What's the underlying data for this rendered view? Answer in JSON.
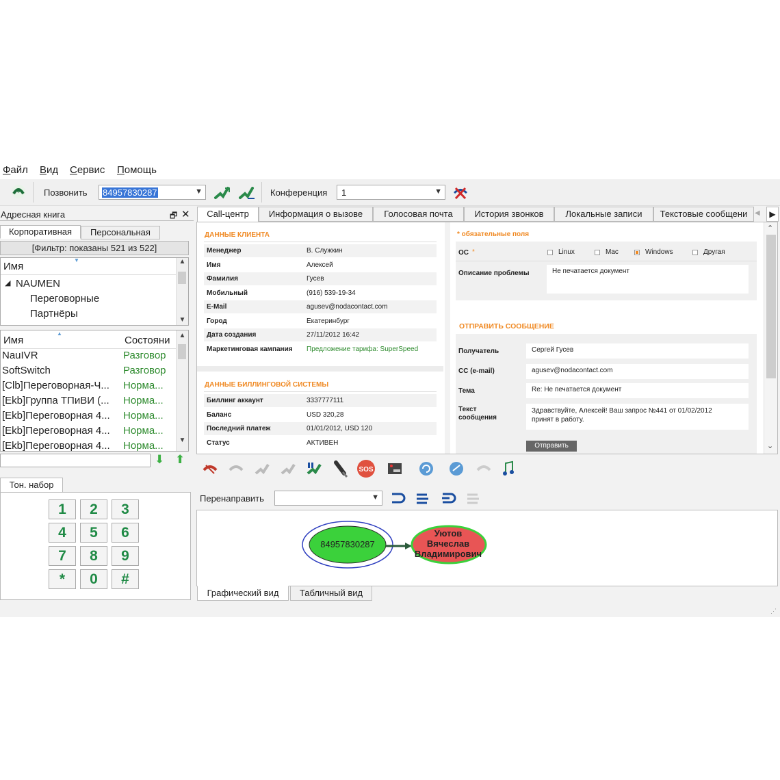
{
  "menu": [
    "Файл",
    "Вид",
    "Сервис",
    "Помощь"
  ],
  "toolbar": {
    "call_label": "Позвонить",
    "call_number": "84957830287",
    "conference_label": "Конференция",
    "conference_value": "1"
  },
  "address_book": {
    "title": "Адресная книга",
    "tabs": [
      "Корпоративная",
      "Персональная"
    ],
    "filter_text": "[Фильтр: показаны 521 из 522]",
    "tree_header": "Имя",
    "tree": [
      "NAUMEN",
      "Переговорные",
      "Партнёры"
    ],
    "list_headers": [
      "Имя",
      "Состояни"
    ],
    "rows": [
      {
        "name": "NauIVR",
        "state": "Разговор"
      },
      {
        "name": "SoftSwitch",
        "state": "Разговор"
      },
      {
        "name": "[Clb]Переговорная-Ч...",
        "state": "Норма..."
      },
      {
        "name": "[Ekb]Группа ТПиВИ (...",
        "state": "Норма..."
      },
      {
        "name": "[Ekb]Переговорная 4...",
        "state": "Норма..."
      },
      {
        "name": "[Ekb]Переговорная 4...",
        "state": "Норма..."
      },
      {
        "name": "[Ekb]Переговорная 4...",
        "state": "Норма..."
      }
    ]
  },
  "dialpad": {
    "tab": "Тон. набор",
    "keys": [
      "1",
      "2",
      "3",
      "4",
      "5",
      "6",
      "7",
      "8",
      "9",
      "*",
      "0",
      "#"
    ]
  },
  "main_tabs": [
    "Call-центр",
    "Информация о вызове",
    "Голосовая почта",
    "История звонков",
    "Локальные записи",
    "Текстовые сообщени"
  ],
  "client": {
    "title": "ДАННЫЕ КЛИЕНТА",
    "rows": [
      {
        "k": "Менеджер",
        "v": "В. Служкин"
      },
      {
        "k": "Имя",
        "v": "Алексей"
      },
      {
        "k": "Фамилия",
        "v": "Гусев"
      },
      {
        "k": "Мобильный",
        "v": "(916) 539-19-34"
      },
      {
        "k": "E-Mail",
        "v": "agusev@nodacontact.com"
      },
      {
        "k": "Город",
        "v": "Екатеринбург"
      },
      {
        "k": "Дата создания",
        "v": "27/11/2012 16:42"
      },
      {
        "k": "Маркетинговая кампания",
        "v": "Предложение тарифа: SuperSpeed"
      }
    ]
  },
  "billing": {
    "title": "ДАННЫЕ БИЛЛИНГОВОЙ СИСТЕМЫ",
    "rows": [
      {
        "k": "Биллинг аккаунт",
        "v": "3337777111"
      },
      {
        "k": "Баланс",
        "v": "USD 320,28"
      },
      {
        "k": "Последний платеж",
        "v": "01/01/2012, USD 120"
      },
      {
        "k": "Статус",
        "v": "АКТИВЕН"
      }
    ]
  },
  "form": {
    "required_note": "*  обязательные поля",
    "os_label": "ОС",
    "os_options": [
      "Linux",
      "Mac",
      "Windows",
      "Другая"
    ],
    "os_selected": "Windows",
    "problem_label": "Описание проблемы",
    "problem_value": "Не печатается документ"
  },
  "message": {
    "title": "ОТПРАВИТЬ СООБЩЕНИЕ",
    "recipient_label": "Получатель",
    "recipient_value": "Сергей Гусев",
    "cc_label": "CC (e-mail)",
    "cc_value": "agusev@nodacontact.com",
    "subject_label": "Тема",
    "subject_value": "Re: Не печатается документ",
    "text_label_1": "Текст",
    "text_label_2": "сообщения",
    "text_line_1": "Здравствуйте, Алексей! Ваш запрос №441 от 01/02/2012",
    "text_line_2": "принят в работу.",
    "send_button": "Отправить"
  },
  "redirect": {
    "label": "Перенаправить",
    "value": ""
  },
  "graph": {
    "caller": "84957830287",
    "callee_1": "Уютов",
    "callee_2": "Вячеслав",
    "callee_3": "Владимирович"
  },
  "bottom_tabs": [
    "Графический вид",
    "Табличный вид"
  ],
  "colors": {
    "accent": "#f08a24",
    "green_node": "#3bd13b",
    "red_node": "#e85555",
    "status_green": "#2e8b2e"
  }
}
